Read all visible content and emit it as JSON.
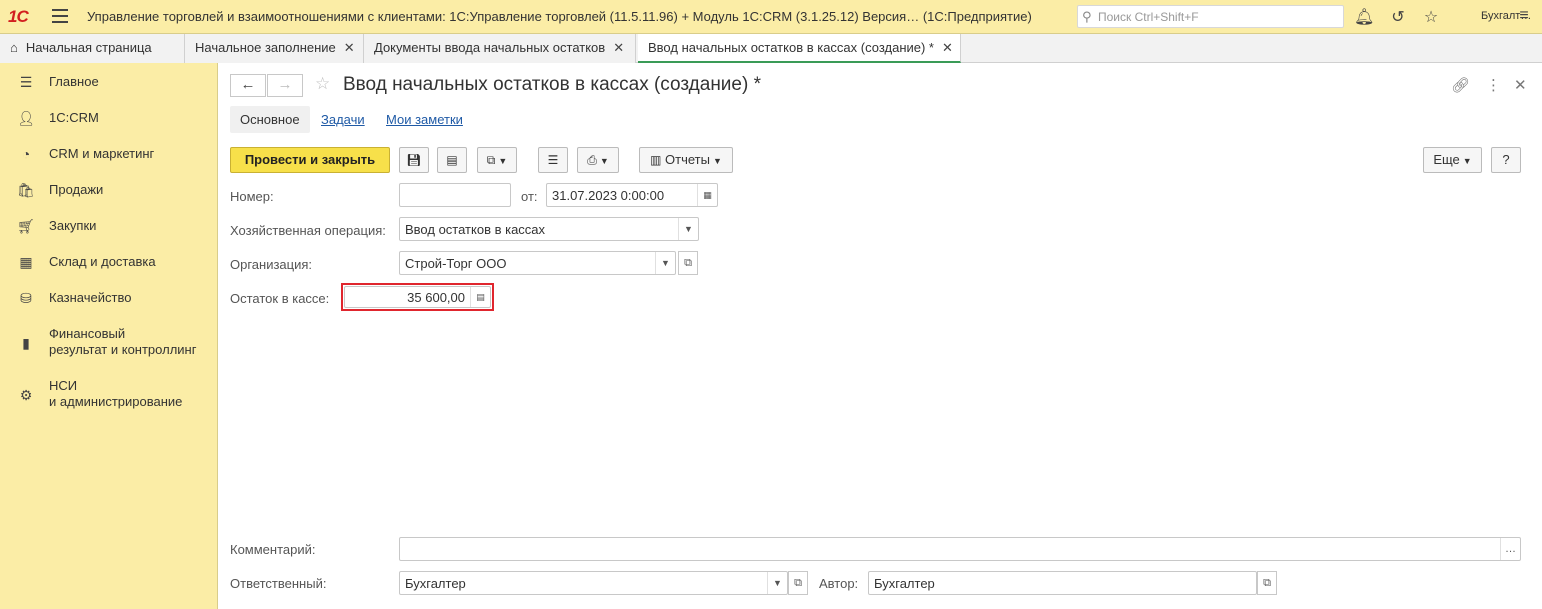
{
  "topbar": {
    "logo": "1С",
    "title": "Управление торговлей и взаимоотношениями с клиентами: 1С:Управление торговлей (11.5.11.96) + Модуль 1С:CRM (3.1.25.12) Версия…  (1С:Предприятие)",
    "search_placeholder": "Поиск Ctrl+Shift+F",
    "user": "Бухгалт…"
  },
  "tabs": [
    {
      "label": "Начальная страница"
    },
    {
      "label": "Начальное заполнение"
    },
    {
      "label": "Документы ввода начальных остатков"
    },
    {
      "label": "Ввод начальных остатков в кассах (создание) *"
    }
  ],
  "sidebar": {
    "items": [
      {
        "label": "Главное"
      },
      {
        "label": "1С:CRM"
      },
      {
        "label": "CRM и маркетинг"
      },
      {
        "label": "Продажи"
      },
      {
        "label": "Закупки"
      },
      {
        "label": "Склад и доставка"
      },
      {
        "label": "Казначейство"
      },
      {
        "label_line1": "Финансовый",
        "label_line2": "результат и контроллинг"
      },
      {
        "label_line1": "НСИ",
        "label_line2": "и администрирование"
      }
    ]
  },
  "document": {
    "title": "Ввод начальных остатков в кассах (создание) *",
    "subtabs": [
      "Основное",
      "Задачи",
      "Мои заметки"
    ],
    "toolbar": {
      "post_close": "Провести и закрыть",
      "reports": "Отчеты",
      "more": "Еще",
      "help": "?"
    },
    "fields": {
      "number_label": "Номер:",
      "number_value": "",
      "from_label": "от:",
      "date_value": "31.07.2023  0:00:00",
      "operation_label": "Хозяйственная операция:",
      "operation_value": "Ввод остатков в кассах",
      "org_label": "Организация:",
      "org_value": "Строй-Торг ООО",
      "balance_label": "Остаток в кассе:",
      "balance_value": "35 600,00",
      "comment_label": "Комментарий:",
      "comment_value": "",
      "responsible_label": "Ответственный:",
      "responsible_value": "Бухгалтер",
      "author_label": "Автор:",
      "author_value": "Бухгалтер"
    }
  },
  "colors": {
    "accent_yellow": "#fbeda6",
    "primary_button": "#f7e04a",
    "active_tab_underline": "#3a9b57",
    "highlight_red": "#e0262e",
    "link_blue": "#1f5aa6"
  }
}
